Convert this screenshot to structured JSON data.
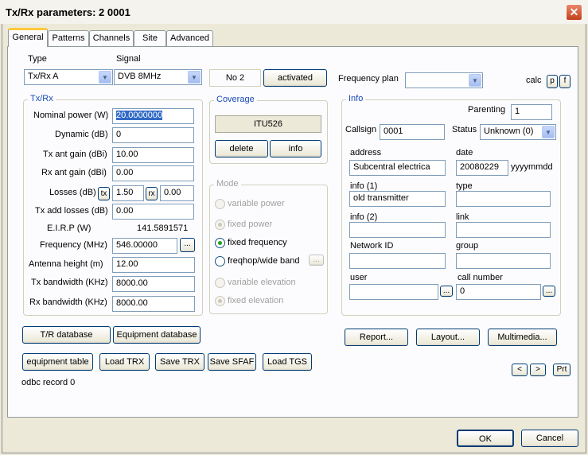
{
  "window": {
    "title": "Tx/Rx parameters:  2 0001",
    "close_label": "✕"
  },
  "tabs": [
    "General",
    "Patterns",
    "Channels",
    "Site",
    "Advanced"
  ],
  "type_label": "Type",
  "type_value": "Tx/Rx A",
  "signal_label": "Signal",
  "signal_value": "DVB 8MHz",
  "no_label": "No 2",
  "activated_label": "activated",
  "frequency_plan_label": "Frequency plan",
  "frequency_plan_value": "",
  "calc_label": "calc",
  "calc_p": "p",
  "calc_f": "f",
  "txrx": {
    "title": "Tx/Rx",
    "nominal_power_label": "Nominal power (W)",
    "nominal_power_value": "20.0000000",
    "dynamic_label": "Dynamic (dB)",
    "dynamic_value": "0",
    "tx_ant_gain_label": "Tx ant gain (dBi)",
    "tx_ant_gain_value": "10.00",
    "rx_ant_gain_label": "Rx ant gain (dBi)",
    "rx_ant_gain_value": "0.00",
    "losses_label": "Losses (dB)",
    "losses_tx_btn": "tx",
    "losses_tx_value": "1.50",
    "losses_rx_btn": "rx",
    "losses_rx_value": "0.00",
    "tx_add_losses_label": "Tx add losses (dB)",
    "tx_add_losses_value": "0.00",
    "eirp_label": "E.I.R.P (W)",
    "eirp_value": "141.5891571",
    "frequency_label": "Frequency (MHz)",
    "frequency_value": "546.00000",
    "frequency_btn": "...",
    "antenna_height_label": "Antenna height (m)",
    "antenna_height_value": "12.00",
    "tx_bandwidth_label": "Tx bandwidth (KHz)",
    "tx_bandwidth_value": "8000.00",
    "rx_bandwidth_label": "Rx bandwidth (KHz)",
    "rx_bandwidth_value": "8000.00"
  },
  "coverage": {
    "title": "Coverage",
    "value": "ITU526",
    "delete_label": "delete",
    "info_label": "info"
  },
  "mode": {
    "title": "Mode",
    "options": [
      "variable power",
      "fixed power",
      "fixed frequency",
      "freqhop/wide band",
      "variable elevation",
      "fixed elevation"
    ],
    "freqhop_btn": "..."
  },
  "info": {
    "title": "Info",
    "parenting_label": "Parenting",
    "parenting_value": "1",
    "callsign_label": "Callsign",
    "callsign_value": "0001",
    "status_label": "Status",
    "status_value": "Unknown (0)",
    "address_label": "address",
    "address_value": "Subcentral electrica",
    "date_label": "date",
    "date_value": "20080229",
    "date_format": "yyyymmdd",
    "info1_label": "info (1)",
    "info1_value": "old transmitter",
    "type_label": "type",
    "type_value": "",
    "info2_label": "info (2)",
    "info2_value": "",
    "link_label": "link",
    "link_value": "",
    "network_id_label": "Network ID",
    "network_id_value": "",
    "group_label": "group",
    "group_value": "",
    "user_label": "user",
    "user_value": "",
    "user_btn": "...",
    "call_number_label": "call number",
    "call_number_value": "0",
    "call_number_btn": "..."
  },
  "buttons": {
    "tr_database": "T/R database",
    "equipment_database": "Equipment database",
    "report": "Report...",
    "layout": "Layout...",
    "multimedia": "Multimedia...",
    "equipment_table": "equipment  table",
    "load_trx": "Load TRX",
    "save_trx": "Save TRX",
    "save_sfaf": "Save SFAF",
    "load_tgs": "Load TGS",
    "prev": "<",
    "next": ">",
    "prt": "Prt",
    "ok": "OK",
    "cancel": "Cancel"
  },
  "odbc_record": "odbc record 0"
}
